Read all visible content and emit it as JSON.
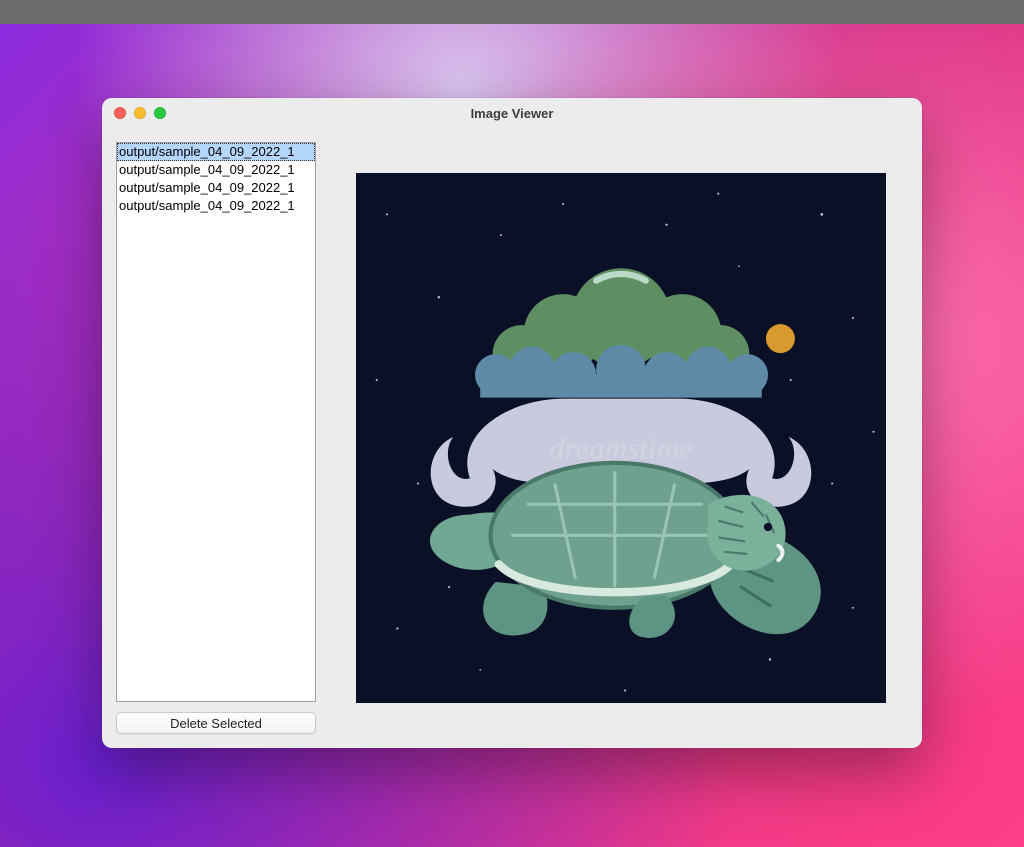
{
  "window": {
    "title": "Image Viewer"
  },
  "file_list": {
    "items": [
      "output/sample_04_09_2022_1",
      "output/sample_04_09_2022_1",
      "output/sample_04_09_2022_1",
      "output/sample_04_09_2022_1"
    ],
    "selected_index": 0
  },
  "buttons": {
    "delete_selected": "Delete Selected"
  },
  "preview": {
    "watermark_text": "dreamstime"
  }
}
